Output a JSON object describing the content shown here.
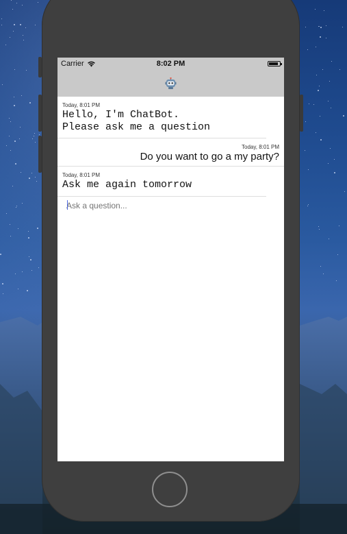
{
  "status_bar": {
    "carrier": "Carrier",
    "time": "8:02 PM"
  },
  "nav_bar": {
    "icon": "robot-icon"
  },
  "messages": [
    {
      "side": "left",
      "timestamp": "Today, 8:01 PM",
      "lines": [
        "Hello, I'm ChatBot.",
        "Please ask me a question"
      ]
    },
    {
      "side": "right",
      "timestamp": "Today, 8:01 PM",
      "lines": [
        "Do you want to go a my party?"
      ]
    },
    {
      "side": "left",
      "timestamp": "Today, 8:01 PM",
      "lines": [
        "Ask me again tomorrow"
      ]
    }
  ],
  "input": {
    "placeholder": "Ask a question...",
    "value": ""
  },
  "colors": {
    "device": "#3f3f3f",
    "nav_bar": "#c9c9c9",
    "caret": "#4a66e0"
  }
}
